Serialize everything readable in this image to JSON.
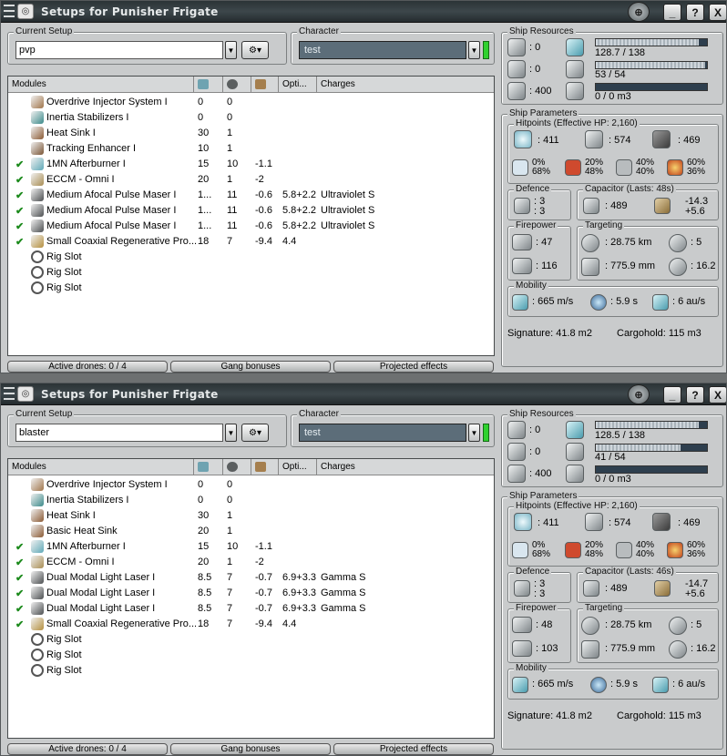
{
  "window": {
    "title": "Setups for Punisher Frigate",
    "min": "_",
    "help": "?",
    "close": "X"
  },
  "labels": {
    "current_setup": "Current Setup",
    "character": "Character",
    "modules_col": "Modules",
    "optimal_col": "Opti...",
    "charges_col": "Charges",
    "ship_resources": "Ship Resources",
    "ship_parameters": "Ship Parameters",
    "defence": "Defence",
    "firepower": "Firepower",
    "targeting": "Targeting",
    "mobility": "Mobility",
    "active_drones": "Active drones: 0 / 4",
    "gang_bonuses": "Gang bonuses",
    "projected_effects": "Projected effects"
  },
  "colors": {
    "titlebar": "#2b3336",
    "panel": "#c9cbcc",
    "check": "#1c8a1c",
    "character_active": "#2fd12f"
  },
  "setups": [
    {
      "setup_name": "pvp",
      "character": "test",
      "modules": [
        {
          "check": "",
          "icon": "overdrive-icon",
          "name": "Overdrive Injector System I",
          "cpu": "0",
          "pg": "0",
          "cap": "",
          "optimal": "",
          "charges": ""
        },
        {
          "check": "",
          "icon": "inertia-icon",
          "name": "Inertia Stabilizers I",
          "cpu": "0",
          "pg": "0",
          "cap": "",
          "optimal": "",
          "charges": ""
        },
        {
          "check": "",
          "icon": "heatsink-icon",
          "name": "Heat Sink I",
          "cpu": "30",
          "pg": "1",
          "cap": "",
          "optimal": "",
          "charges": ""
        },
        {
          "check": "",
          "icon": "tracking-icon",
          "name": "Tracking Enhancer I",
          "cpu": "10",
          "pg": "1",
          "cap": "",
          "optimal": "",
          "charges": ""
        },
        {
          "check": "✔",
          "icon": "afterburner-icon",
          "name": "1MN Afterburner I",
          "cpu": "15",
          "pg": "10",
          "cap": "-1.1",
          "optimal": "",
          "charges": ""
        },
        {
          "check": "✔",
          "icon": "eccm-icon",
          "name": "ECCM - Omni I",
          "cpu": "20",
          "pg": "1",
          "cap": "-2",
          "optimal": "",
          "charges": ""
        },
        {
          "check": "✔",
          "icon": "laser-icon",
          "name": "Medium Afocal Pulse Maser I",
          "cpu": "1...",
          "pg": "11",
          "cap": "-0.6",
          "optimal": "5.8+2.2",
          "charges": "Ultraviolet S"
        },
        {
          "check": "✔",
          "icon": "laser-icon",
          "name": "Medium Afocal Pulse Maser I",
          "cpu": "1...",
          "pg": "11",
          "cap": "-0.6",
          "optimal": "5.8+2.2",
          "charges": "Ultraviolet S"
        },
        {
          "check": "✔",
          "icon": "laser-icon",
          "name": "Medium Afocal Pulse Maser I",
          "cpu": "1...",
          "pg": "11",
          "cap": "-0.6",
          "optimal": "5.8+2.2",
          "charges": "Ultraviolet S"
        },
        {
          "check": "✔",
          "icon": "regen-icon",
          "name": "Small Coaxial Regenerative Pro...",
          "cpu": "18",
          "pg": "7",
          "cap": "-9.4",
          "optimal": "4.4",
          "charges": ""
        },
        {
          "check": "",
          "icon": "rig-slot-icon",
          "name": "Rig Slot",
          "cpu": "",
          "pg": "",
          "cap": "",
          "optimal": "",
          "charges": ""
        },
        {
          "check": "",
          "icon": "rig-slot-icon",
          "name": "Rig Slot",
          "cpu": "",
          "pg": "",
          "cap": "",
          "optimal": "",
          "charges": ""
        },
        {
          "check": "",
          "icon": "rig-slot-icon",
          "name": "Rig Slot",
          "cpu": "",
          "pg": "",
          "cap": "",
          "optimal": "",
          "charges": ""
        }
      ],
      "resources": {
        "turret": ": 0",
        "launcher": ": 0",
        "calibration": ": 400",
        "cpu": "128.7 / 138",
        "cpu_pct": 0.93,
        "pg": "53 / 54",
        "pg_pct": 0.98,
        "drone_bay": "0 / 0 m3",
        "drone_pct": 0
      },
      "hitpoints": {
        "title": "Hitpoints (Effective HP: 2,160)",
        "shield": ": 411",
        "armor": ": 574",
        "structure": ": 469",
        "res": [
          [
            "0%",
            "68%"
          ],
          [
            "20%",
            "48%"
          ],
          [
            "40%",
            "40%"
          ],
          [
            "60%",
            "36%"
          ]
        ]
      },
      "defence": {
        "a": ": 3",
        "b": ": 3"
      },
      "capacitor": {
        "title": "Capacitor (Lasts: 48s)",
        "cap": ": 489",
        "rate": "-14.3",
        "regen": "+5.6"
      },
      "firepower": {
        "dps": ": 47",
        "volley": ": 116"
      },
      "targeting": {
        "range": ": 28.75 km",
        "targets": ": 5",
        "scan": ": 775.9 mm",
        "sensor": ": 16.2"
      },
      "mobility": {
        "speed": ": 665 m/s",
        "align": ": 5.9 s",
        "warp": ": 6 au/s"
      },
      "signature": "Signature: 41.8 m2",
      "cargohold": "Cargohold: 115 m3"
    },
    {
      "setup_name": "blaster",
      "character": "test",
      "modules": [
        {
          "check": "",
          "icon": "overdrive-icon",
          "name": "Overdrive Injector System I",
          "cpu": "0",
          "pg": "0",
          "cap": "",
          "optimal": "",
          "charges": ""
        },
        {
          "check": "",
          "icon": "inertia-icon",
          "name": "Inertia Stabilizers I",
          "cpu": "0",
          "pg": "0",
          "cap": "",
          "optimal": "",
          "charges": ""
        },
        {
          "check": "",
          "icon": "heatsink-icon",
          "name": "Heat Sink I",
          "cpu": "30",
          "pg": "1",
          "cap": "",
          "optimal": "",
          "charges": ""
        },
        {
          "check": "",
          "icon": "heatsink-icon",
          "name": "Basic Heat Sink",
          "cpu": "20",
          "pg": "1",
          "cap": "",
          "optimal": "",
          "charges": ""
        },
        {
          "check": "✔",
          "icon": "afterburner-icon",
          "name": "1MN Afterburner I",
          "cpu": "15",
          "pg": "10",
          "cap": "-1.1",
          "optimal": "",
          "charges": ""
        },
        {
          "check": "✔",
          "icon": "eccm-icon",
          "name": "ECCM - Omni I",
          "cpu": "20",
          "pg": "1",
          "cap": "-2",
          "optimal": "",
          "charges": ""
        },
        {
          "check": "✔",
          "icon": "laser-icon",
          "name": "Dual Modal Light Laser I",
          "cpu": "8.5",
          "pg": "7",
          "cap": "-0.7",
          "optimal": "6.9+3.3",
          "charges": "Gamma S"
        },
        {
          "check": "✔",
          "icon": "laser-icon",
          "name": "Dual Modal Light Laser I",
          "cpu": "8.5",
          "pg": "7",
          "cap": "-0.7",
          "optimal": "6.9+3.3",
          "charges": "Gamma S"
        },
        {
          "check": "✔",
          "icon": "laser-icon",
          "name": "Dual Modal Light Laser I",
          "cpu": "8.5",
          "pg": "7",
          "cap": "-0.7",
          "optimal": "6.9+3.3",
          "charges": "Gamma S"
        },
        {
          "check": "✔",
          "icon": "regen-icon",
          "name": "Small Coaxial Regenerative Pro...",
          "cpu": "18",
          "pg": "7",
          "cap": "-9.4",
          "optimal": "4.4",
          "charges": ""
        },
        {
          "check": "",
          "icon": "rig-slot-icon",
          "name": "Rig Slot",
          "cpu": "",
          "pg": "",
          "cap": "",
          "optimal": "",
          "charges": ""
        },
        {
          "check": "",
          "icon": "rig-slot-icon",
          "name": "Rig Slot",
          "cpu": "",
          "pg": "",
          "cap": "",
          "optimal": "",
          "charges": ""
        },
        {
          "check": "",
          "icon": "rig-slot-icon",
          "name": "Rig Slot",
          "cpu": "",
          "pg": "",
          "cap": "",
          "optimal": "",
          "charges": ""
        }
      ],
      "resources": {
        "turret": ": 0",
        "launcher": ": 0",
        "calibration": ": 400",
        "cpu": "128.5 / 138",
        "cpu_pct": 0.93,
        "pg": "41 / 54",
        "pg_pct": 0.76,
        "drone_bay": "0 / 0 m3",
        "drone_pct": 0
      },
      "hitpoints": {
        "title": "Hitpoints (Effective HP: 2,160)",
        "shield": ": 411",
        "armor": ": 574",
        "structure": ": 469",
        "res": [
          [
            "0%",
            "68%"
          ],
          [
            "20%",
            "48%"
          ],
          [
            "40%",
            "40%"
          ],
          [
            "60%",
            "36%"
          ]
        ]
      },
      "defence": {
        "a": ": 3",
        "b": ": 3"
      },
      "capacitor": {
        "title": "Capacitor (Lasts: 46s)",
        "cap": ": 489",
        "rate": "-14.7",
        "regen": "+5.6"
      },
      "firepower": {
        "dps": ": 48",
        "volley": ": 103"
      },
      "targeting": {
        "range": ": 28.75 km",
        "targets": ": 5",
        "scan": ": 775.9 mm",
        "sensor": ": 16.2"
      },
      "mobility": {
        "speed": ": 665 m/s",
        "align": ": 5.9 s",
        "warp": ": 6 au/s"
      },
      "signature": "Signature: 41.8 m2",
      "cargohold": "Cargohold: 115 m3"
    }
  ]
}
